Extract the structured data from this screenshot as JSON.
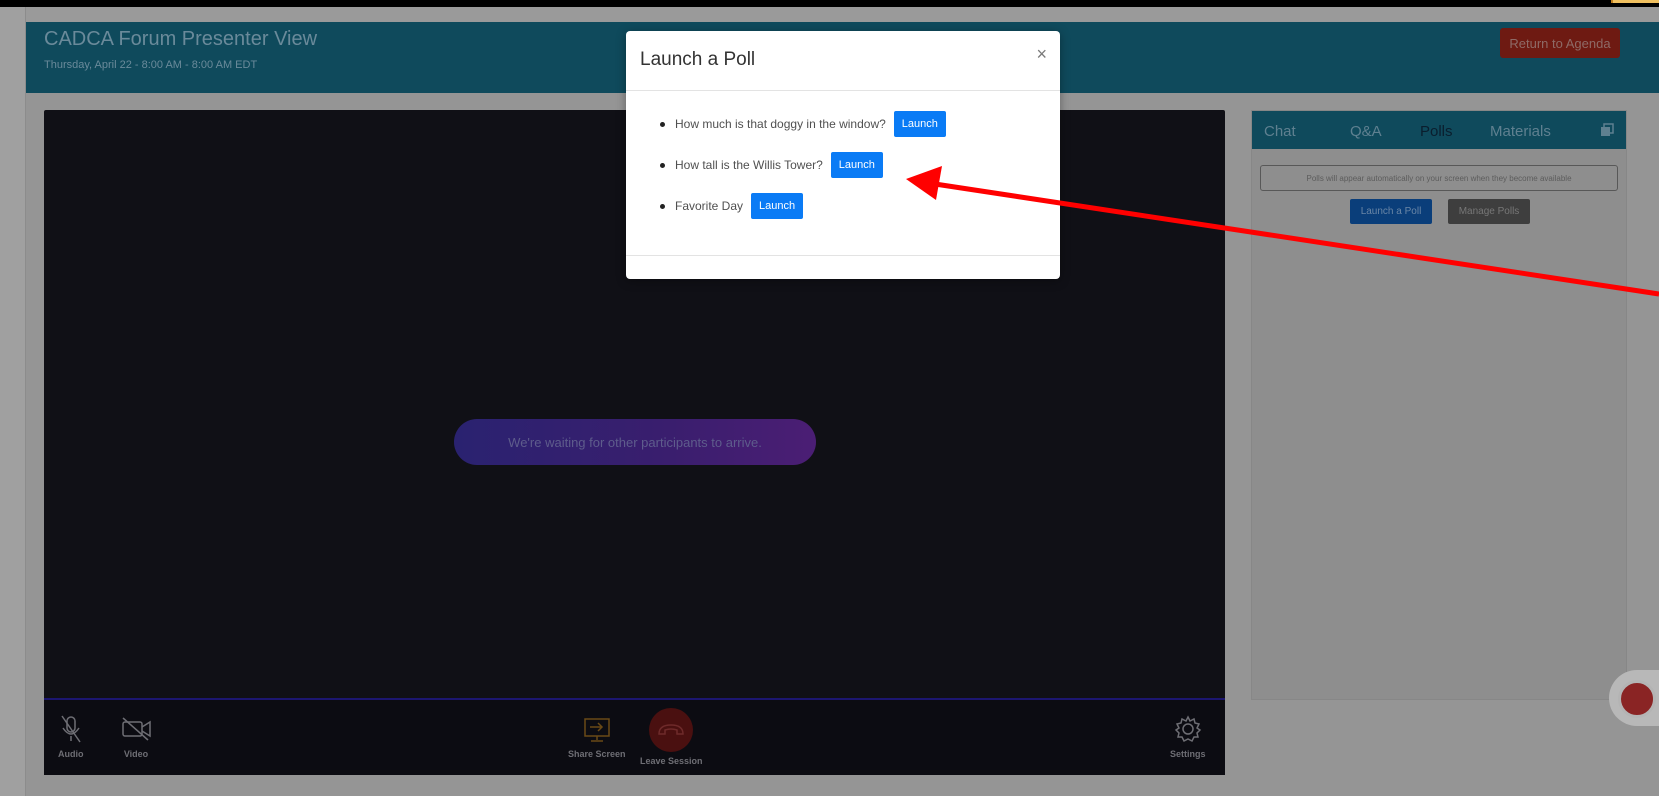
{
  "header": {
    "title": "CADCA Forum Presenter View",
    "subtitle": "Thursday, April 22 - 8:00 AM - 8:00 AM EDT",
    "return_label": "Return to Agenda"
  },
  "video": {
    "waiting_text": "We're waiting for other participants to arrive."
  },
  "controls": {
    "audio": "Audio",
    "video": "Video",
    "share": "Share Screen",
    "leave": "Leave Session",
    "settings": "Settings"
  },
  "sidebar": {
    "tabs": [
      {
        "label": "Chat"
      },
      {
        "label": "Q&A"
      },
      {
        "label": "Polls"
      },
      {
        "label": "Materials"
      }
    ],
    "active_tab": "Polls",
    "note": "Polls will appear automatically on your screen when they become available",
    "launch_label": "Launch a Poll",
    "manage_label": "Manage Polls"
  },
  "modal": {
    "title": "Launch a Poll",
    "close": "×",
    "polls": [
      {
        "question": "How much is that doggy in the window?",
        "button": "Launch"
      },
      {
        "question": "How tall is the Willis Tower?",
        "button": "Launch"
      },
      {
        "question": "Favorite Day",
        "button": "Launch"
      }
    ]
  },
  "colors": {
    "header_bg": "#0f4a5c",
    "return_btn": "#6e1a12",
    "launch_btn": "#0a7bf5",
    "arrow": "#ff0000"
  }
}
